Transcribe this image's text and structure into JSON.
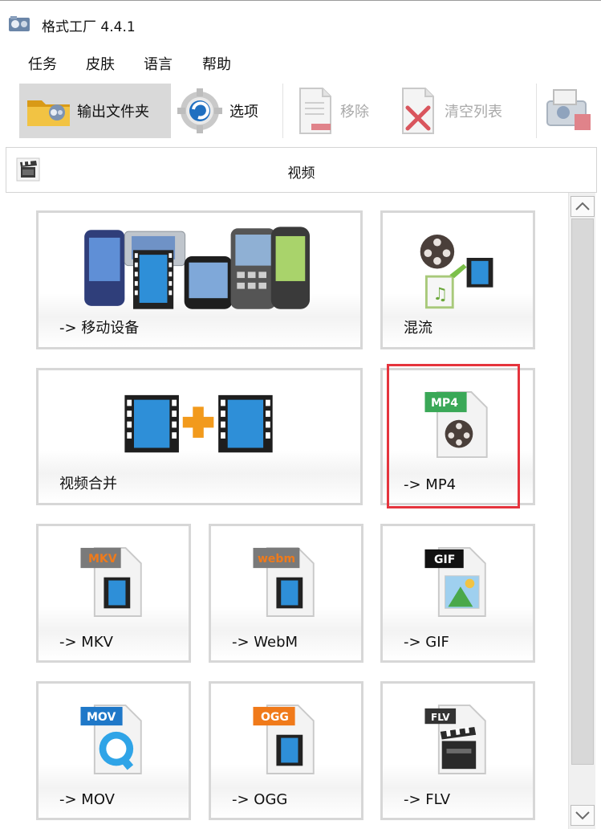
{
  "window": {
    "title": "格式工厂 4.4.1"
  },
  "menu": {
    "items": [
      "任务",
      "皮肤",
      "语言",
      "帮助"
    ]
  },
  "toolbar": {
    "output_folder_label": "输出文件夹",
    "options_label": "选项",
    "remove_label": "移除",
    "clear_list_label": "清空列表"
  },
  "category": {
    "title": "视频"
  },
  "tiles": {
    "mobile": "-> 移动设备",
    "mux": "混流",
    "join": "视频合并",
    "mp4": "-> MP4",
    "mkv": "-> MKV",
    "webm": "-> WebM",
    "gif": "-> GIF",
    "mov": "-> MOV",
    "ogg": "-> OGG",
    "flv": "-> FLV"
  },
  "badges": {
    "mp4": "MP4",
    "mkv": "MKV",
    "webm": "webm",
    "gif": "GIF",
    "mov": "MOV",
    "ogg": "OGG",
    "flv": "FLV"
  },
  "colors": {
    "highlight": "#e5343d",
    "mp4_badge": "#3aa857",
    "mkv_badge": "#f07a1a",
    "webm_badge": "#f07a1a",
    "gif_badge": "#111111",
    "mov_badge": "#1f78c8",
    "ogg_badge": "#f07a1a",
    "flv_badge": "#333333",
    "film_blue": "#2e8fd8"
  },
  "icons": [
    "app-icon",
    "folder-icon",
    "gear-icon",
    "document-icon",
    "document-x-icon",
    "shredder-icon",
    "clapper-icon"
  ]
}
